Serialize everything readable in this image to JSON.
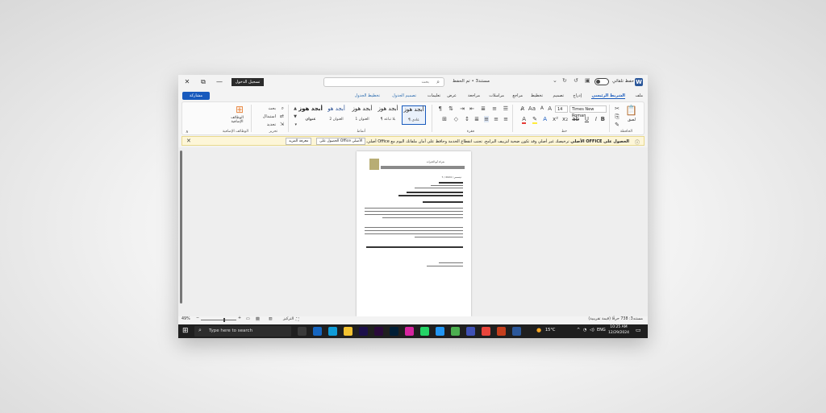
{
  "window": {
    "title": "مستند3 • تم الحفظ",
    "autosave_label": "حفظ تلقائي",
    "signin_label": "تسجيل الدخول",
    "search_placeholder": "بحث",
    "controls": {
      "close": "✕",
      "restore": "⧉",
      "minimize": "—"
    }
  },
  "tabs": {
    "share_label": "مشاركة",
    "items": [
      {
        "id": "file",
        "label": "ملف"
      },
      {
        "id": "home",
        "label": "الشريط الرئيسي",
        "active": true
      },
      {
        "id": "insert",
        "label": "إدراج"
      },
      {
        "id": "design",
        "label": "تصميم"
      },
      {
        "id": "layout",
        "label": "تخطيط"
      },
      {
        "id": "references",
        "label": "مراجع"
      },
      {
        "id": "mailings",
        "label": "مراسلات"
      },
      {
        "id": "review",
        "label": "مراجعة"
      },
      {
        "id": "view",
        "label": "عرض"
      },
      {
        "id": "help",
        "label": "تعليمات"
      },
      {
        "id": "table-design",
        "label": "تصميم الجدول",
        "contextual": true
      },
      {
        "id": "table-layout",
        "label": "تخطيط الجدول",
        "contextual": true
      }
    ]
  },
  "ribbon": {
    "clipboard": {
      "paste": "لصق",
      "label": "الحافظة"
    },
    "font": {
      "name": "Times New Roman",
      "size": "14",
      "label": "خط"
    },
    "paragraph": {
      "label": "فقرة"
    },
    "styles": {
      "label": "أنماط",
      "items": [
        {
          "preview": "أبجد هوز",
          "name": "¶ عادي"
        },
        {
          "preview": "أبجد هوز",
          "name": "¶ بلا تباعد"
        },
        {
          "preview": "أبجد هوز",
          "name": "العنوان 1"
        },
        {
          "preview": "أبجد هو",
          "name": "العنوان 2"
        },
        {
          "preview": "أبجد هوز",
          "name": "عنوان"
        }
      ]
    },
    "editing": {
      "find": "بحث",
      "replace": "استبدال",
      "select": "تحديد",
      "label": "تحرير"
    },
    "addins": {
      "button": "الوظائف الإضافية",
      "label": "الوظائف الإضافية"
    }
  },
  "infobar": {
    "bold": "الحصول على OFFICE الأصلي",
    "text": "ترخيصك غير أصلي وقد تكون ضحية لتزييف البرامج. تجنب انقطاع الخدمة وحافظ على أمان ملفاتك اليوم مع Office أصلي.",
    "get_button": "الحصول على Office الأصلي",
    "learn_button": "معرفة المزيد",
    "close": "✕"
  },
  "document": {
    "company_name": "شركة أبو الخيرات",
    "date_line": "7 / ديسمبر / 2024"
  },
  "statusbar": {
    "words": "مستند3: 738 حرفًا (قيمة تقريبية)",
    "focus": "التركيز",
    "zoom": "49%"
  },
  "taskbar": {
    "search_placeholder": "Type here to search",
    "temperature": "15°C",
    "language": "ENG",
    "time": "10:25 AM",
    "date": "12/29/2024",
    "apps": [
      {
        "name": "task-view",
        "color": "#3a3a3a"
      },
      {
        "name": "mail",
        "color": "#1565c0"
      },
      {
        "name": "edge",
        "color": "#0f9bd7"
      },
      {
        "name": "file-explorer",
        "color": "#f2c230"
      },
      {
        "name": "after-effects",
        "color": "#1b0f4a"
      },
      {
        "name": "premiere",
        "color": "#2a0a3a"
      },
      {
        "name": "photoshop",
        "color": "#001e36"
      },
      {
        "name": "instagram",
        "color": "#d6249f"
      },
      {
        "name": "whatsapp",
        "color": "#25d366"
      },
      {
        "name": "water-drop",
        "color": "#2196f3"
      },
      {
        "name": "vpn",
        "color": "#4caf50"
      },
      {
        "name": "control-panel",
        "color": "#3f51b5"
      },
      {
        "name": "chrome",
        "color": "#e8453c"
      },
      {
        "name": "powerpoint",
        "color": "#c43e1c"
      },
      {
        "name": "word",
        "color": "#2b579a"
      }
    ]
  },
  "colors": {
    "accent": "#185abd",
    "infobar_bg": "#fdf6d8",
    "taskbar_bg": "#1f1f1f",
    "letterhead_gold": "#b8ad74"
  }
}
